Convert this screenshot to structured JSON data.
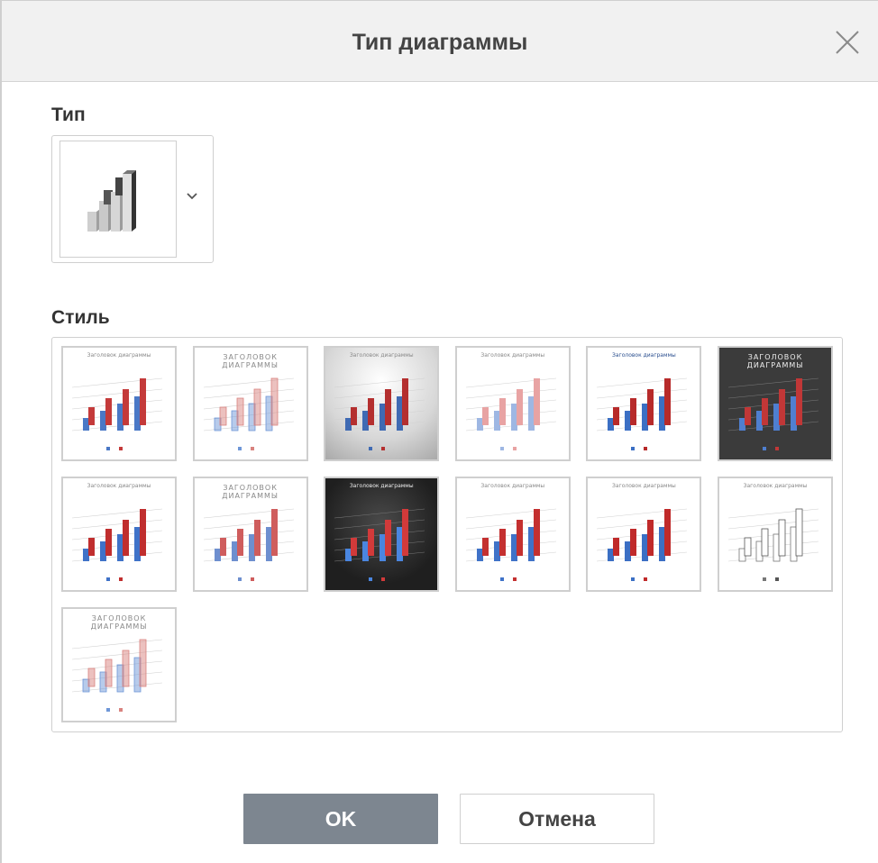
{
  "dialog": {
    "title": "Тип диаграммы",
    "close_icon": "close-icon"
  },
  "type_section": {
    "label": "Тип",
    "selected_icon": "3d-column-chart-icon",
    "dropdown_icon": "chevron-down-icon"
  },
  "style_section": {
    "label": "Стиль",
    "styles": [
      {
        "title": "Заголовок диаграммы",
        "variant": "light-red-blue",
        "colors": {
          "bg": "#ffffff",
          "a": "#4a78c6",
          "b": "#c43a3a"
        }
      },
      {
        "title": "ЗАГОЛОВОК ДИАГРАММЫ",
        "variant": "striped",
        "colors": {
          "bg": "#ffffff",
          "a": "#6f97d8",
          "b": "#d9837f"
        }
      },
      {
        "title": "Заголовок диаграммы",
        "variant": "gradient-gray",
        "colors": {
          "bg": "#bdbdbd",
          "a": "#3f6ab3",
          "b": "#b42f2f"
        }
      },
      {
        "title": "Заголовок диаграммы",
        "variant": "pastel",
        "colors": {
          "bg": "#ffffff",
          "a": "#9eb7e3",
          "b": "#e8a3a3"
        }
      },
      {
        "title": "Заголовок диаграммы",
        "variant": "light-bold-title",
        "colors": {
          "bg": "#ffffff",
          "a": "#3b6fc4",
          "b": "#b72a2a"
        }
      },
      {
        "title": "ЗАГОЛОВОК ДИАГРАММЫ",
        "variant": "dark",
        "colors": {
          "bg": "#3b3b3b",
          "a": "#4f7fd0",
          "b": "#c13737"
        }
      },
      {
        "title": "Заголовок диаграммы",
        "variant": "light-red-blue",
        "colors": {
          "bg": "#ffffff",
          "a": "#3f72c8",
          "b": "#c02e2e"
        }
      },
      {
        "title": "ЗАГОЛОВОК ДИАГРАММЫ",
        "variant": "soft-gradient",
        "colors": {
          "bg": "#ffffff",
          "a": "#6e8fcf",
          "b": "#cf5d5d"
        }
      },
      {
        "title": "Заголовок диаграммы",
        "variant": "black",
        "colors": {
          "bg": "#1f1f1f",
          "a": "#4a86e0",
          "b": "#d23a3a"
        }
      },
      {
        "title": "Заголовок диаграммы",
        "variant": "light-red-blue",
        "colors": {
          "bg": "#ffffff",
          "a": "#3f72c8",
          "b": "#c43030"
        }
      },
      {
        "title": "Заголовок диаграммы",
        "variant": "light-red-blue",
        "colors": {
          "bg": "#ffffff",
          "a": "#3b6fc4",
          "b": "#c02a2a"
        }
      },
      {
        "title": "Заголовок диаграммы",
        "variant": "outline",
        "colors": {
          "bg": "#ffffff",
          "a": "#777777",
          "b": "#555555"
        }
      },
      {
        "title": "ЗАГОЛОВОК ДИАГРАММЫ",
        "variant": "pattern",
        "colors": {
          "bg": "#ffffff",
          "a": "#6f97d8",
          "b": "#d9837f"
        }
      }
    ]
  },
  "buttons": {
    "ok": "OK",
    "cancel": "Отмена"
  }
}
